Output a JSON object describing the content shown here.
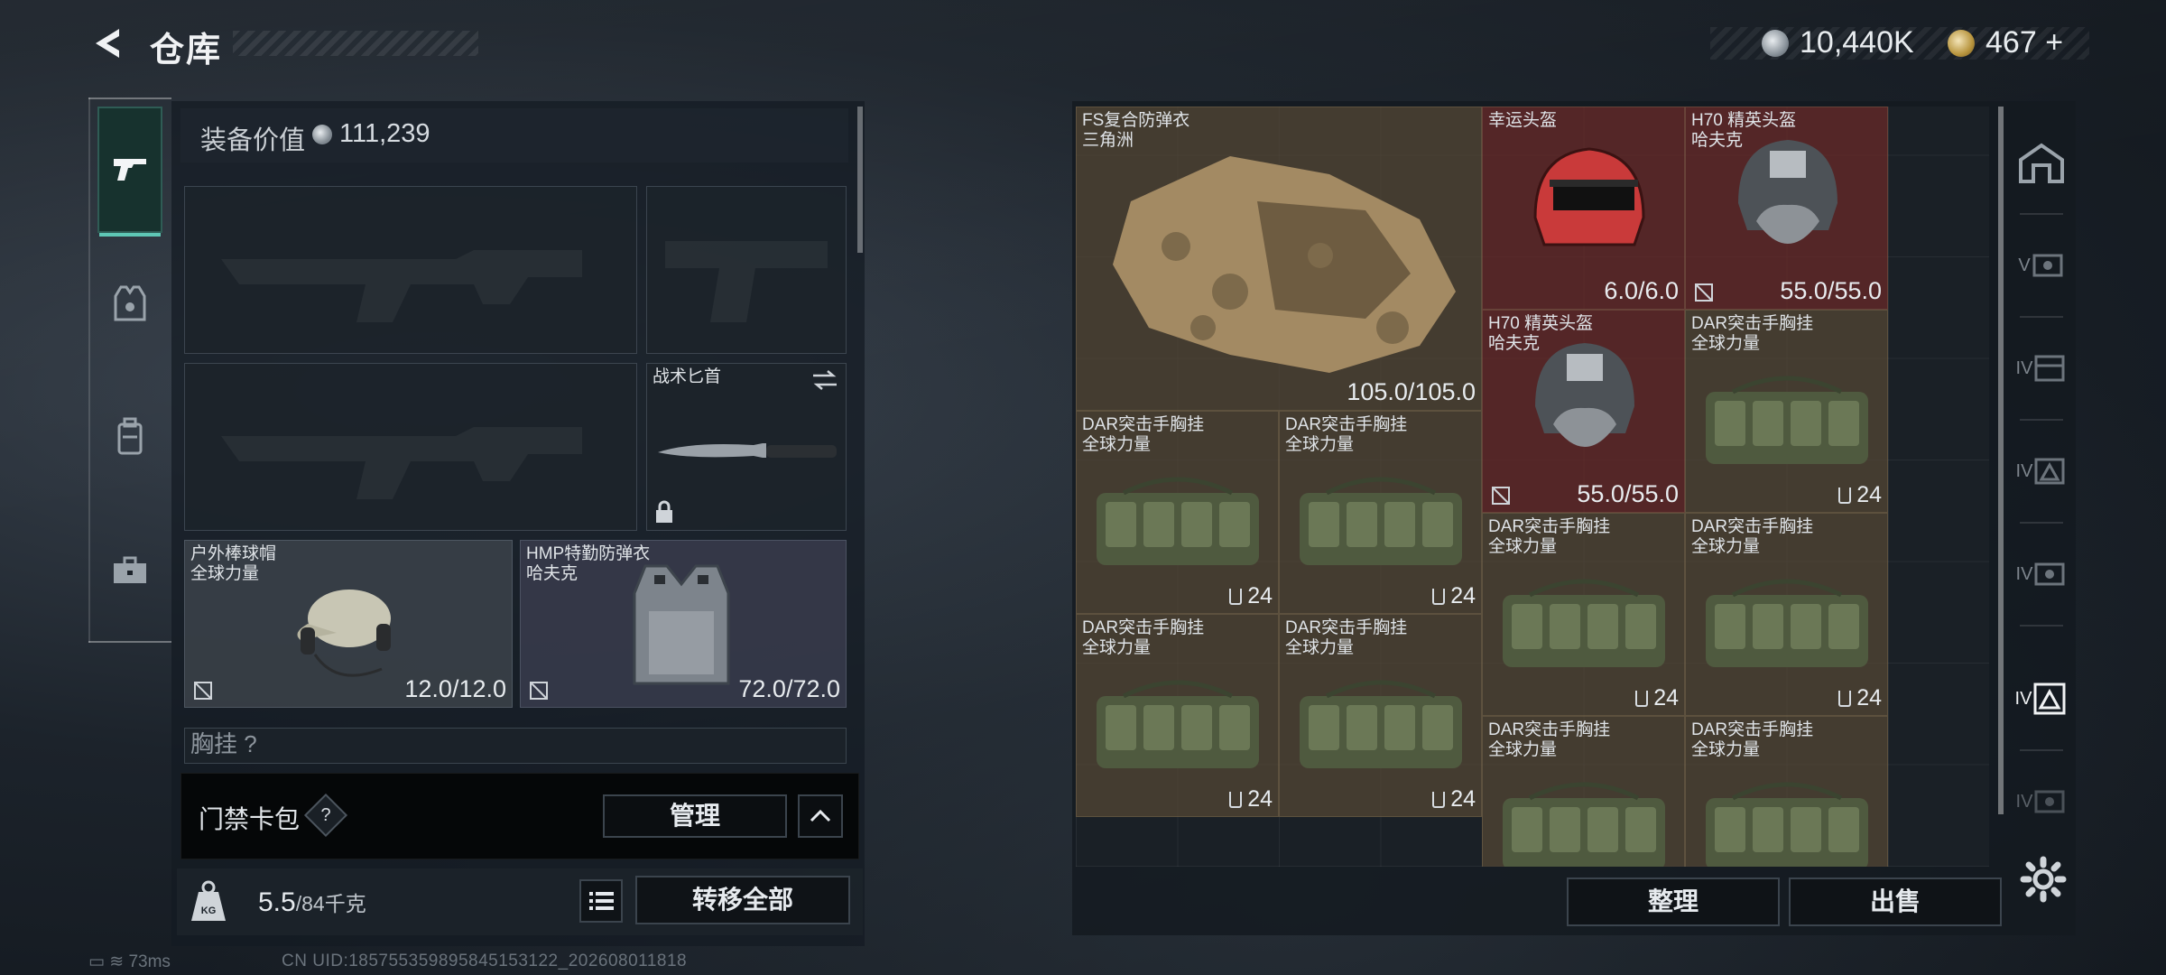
{
  "header": {
    "title": "仓库",
    "currency_silver": "10,440K",
    "currency_gold": "467",
    "gold_plus": "+"
  },
  "equipment": {
    "value_label": "装备价值",
    "value": "111,239",
    "slots": {
      "knife": {
        "label": "战术匕首"
      },
      "helmet": {
        "label": "户外棒球帽\n全球力量",
        "durability": "12.0/12.0"
      },
      "vest": {
        "label": "HMP特勤防弹衣\n哈夫克",
        "durability": "72.0/72.0"
      },
      "chest": {
        "label": "胸挂 ?"
      }
    }
  },
  "keybag": {
    "label": "门禁卡包",
    "help": "?",
    "manage_button": "管理"
  },
  "weight": {
    "current": "5.5",
    "max": "/84千克",
    "unit_icon": "KG"
  },
  "transfer_all_button": "转移全部",
  "status": {
    "ping": "73ms",
    "uid": "CN UID:185755359895845153122_202608011818"
  },
  "stash": {
    "items": [
      {
        "id": "fs",
        "label": "FS复合防弹衣\n三角洲",
        "value": "105.0/105.0"
      },
      {
        "id": "lucky",
        "label": "幸运头盔",
        "value": "6.0/6.0"
      },
      {
        "id": "h70a",
        "label": "H70 精英头盔\n哈夫克",
        "value": "55.0/55.0"
      },
      {
        "id": "h70b",
        "label": "H70 精英头盔\n哈夫克",
        "value": "55.0/55.0"
      },
      {
        "id": "dar1",
        "label": "DAR突击手胸挂\n全球力量",
        "count": "24"
      },
      {
        "id": "dar2",
        "label": "DAR突击手胸挂\n全球力量",
        "count": "24"
      },
      {
        "id": "dar3",
        "label": "DAR突击手胸挂\n全球力量",
        "count": "24"
      },
      {
        "id": "dar4",
        "label": "DAR突击手胸挂\n全球力量",
        "count": "24"
      },
      {
        "id": "dar5",
        "label": "DAR突击手胸挂\n全球力量",
        "count": "24"
      },
      {
        "id": "dar6",
        "label": "DAR突击手胸挂\n全球力量",
        "count": "24"
      },
      {
        "id": "dar7",
        "label": "DAR突击手胸挂\n全球力量",
        "count": "24"
      },
      {
        "id": "dar8",
        "label": "DAR突击手胸挂\n全球力量"
      },
      {
        "id": "dar9",
        "label": "DAR突击手胸挂\n全球力量"
      }
    ],
    "sort_button": "整理",
    "sell_button": "出售"
  },
  "right_rail": {
    "tiers": [
      "V",
      "IV",
      "IV",
      "IV",
      "IV",
      "IV"
    ]
  },
  "colors": {
    "accent": "#5ec7b5",
    "brown_item": "#54463a",
    "red_item": "#622828"
  }
}
